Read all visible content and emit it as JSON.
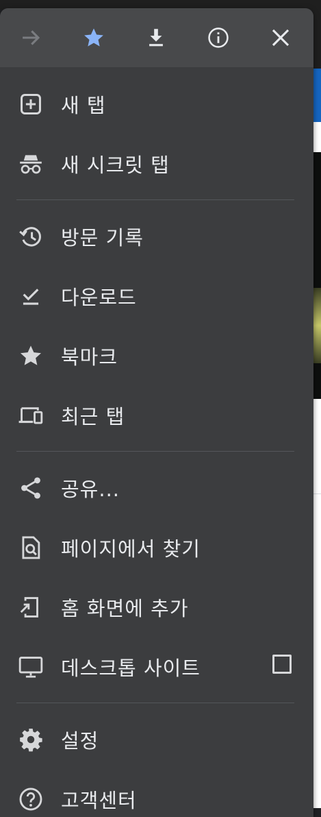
{
  "toolbar": {
    "buttons": [
      {
        "id": "forward",
        "icon": "arrow-right-icon",
        "enabled": false
      },
      {
        "id": "bookmark",
        "icon": "star-icon",
        "active": true
      },
      {
        "id": "download",
        "icon": "download-icon"
      },
      {
        "id": "info",
        "icon": "info-icon"
      },
      {
        "id": "close",
        "icon": "close-icon"
      }
    ]
  },
  "menu": {
    "new_tab": "새 탭",
    "new_incognito_tab": "새 시크릿 탭",
    "history": "방문 기록",
    "downloads": "다운로드",
    "bookmarks": "북마크",
    "recent_tabs": "최근 탭",
    "share": "공유...",
    "find_in_page": "페이지에서 찾기",
    "add_to_home": "홈 화면에 추가",
    "desktop_site": "데스크톱 사이트",
    "desktop_site_checked": false,
    "settings": "설정",
    "help": "고객센터"
  },
  "colors": {
    "menu_bg": "#3c3d3f",
    "toolbar_bg": "#48494b",
    "text": "#e8eaed",
    "icon": "#d6d7d9",
    "accent_star": "#8ab4f8",
    "disabled": "#7a7c80"
  }
}
